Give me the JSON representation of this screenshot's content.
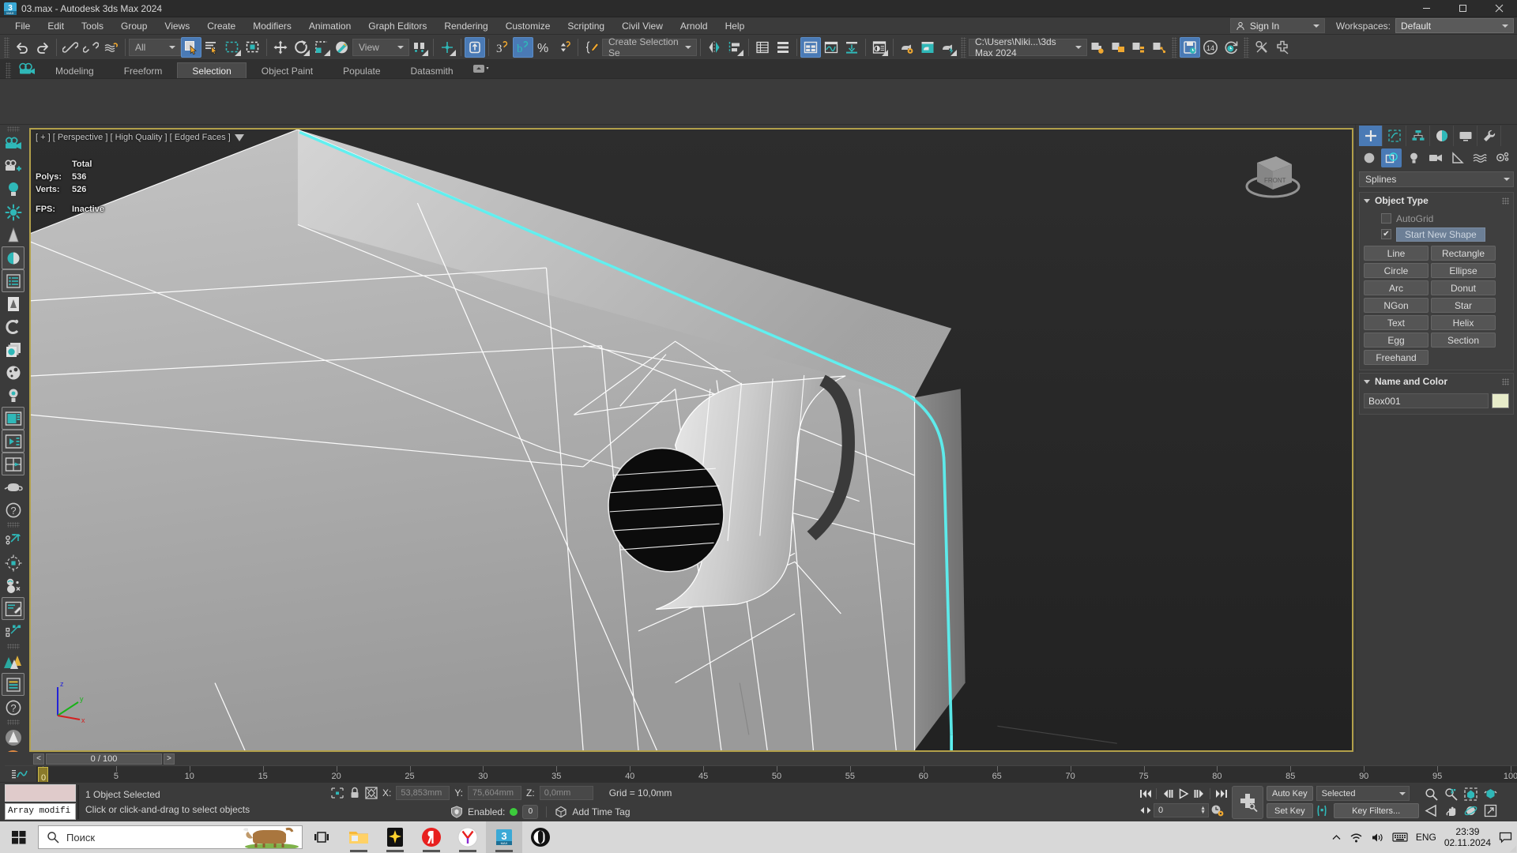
{
  "window": {
    "title": "03.max - Autodesk 3ds Max 2024",
    "app_icon": "3dsmax-icon",
    "minimize": "minimize-icon",
    "maximize": "maximize-icon",
    "close": "close-icon"
  },
  "menubar": {
    "items": [
      "File",
      "Edit",
      "Tools",
      "Group",
      "Views",
      "Create",
      "Modifiers",
      "Animation",
      "Graph Editors",
      "Rendering",
      "Customize",
      "Scripting",
      "Civil View",
      "Arnold",
      "Help"
    ],
    "sign_in": "Sign In",
    "workspaces_label": "Workspaces:",
    "workspace_value": "Default"
  },
  "toolbar": {
    "undo": "undo-icon",
    "redo": "redo-icon",
    "select_and_link": "select-and-link-icon",
    "unlink_selection": "unlink-selection-icon",
    "bind_to_space_warp": "bind-space-warp-icon",
    "filter_value": "All",
    "select_object": "select-object-icon",
    "select_by_name": "select-by-name-icon",
    "rectangular_select": "rectangular-selection-icon",
    "window_crossing": "window-crossing-icon",
    "select_and_move": "select-and-move-icon",
    "select_and_rotate": "select-and-rotate-icon",
    "select_and_scale": "select-and-scale-icon",
    "placement": "placement-icon",
    "reference_coord_value": "View",
    "use_center": "use-pivot-center-icon",
    "select_and_manipulate": "select-and-manipulate-icon",
    "snaps_toggle": "snaps-toggle-icon",
    "angle_snap": "angle-snap-icon",
    "percent_snap": "percent-snap-icon",
    "spinner_snap": "spinner-snap-icon",
    "edit_named_sets": "edit-named-selection-sets-icon",
    "selection_set_value": "Create Selection Se",
    "mirror": "mirror-icon",
    "align": "align-icon",
    "layer_explorer": "layer-explorer-icon",
    "scene_explorer": "scene-explorer-icon",
    "toggle_ribbon": "toggle-ribbon-icon",
    "curve_editor": "curve-editor-icon",
    "schematic_view": "schematic-view-icon",
    "material_editor": "material-editor-icon",
    "render_setup": "render-setup-icon",
    "rendered_frame_window": "rendered-frame-window-icon",
    "render_production": "render-production-icon",
    "project_path_value": "C:\\Users\\Niki...\\3ds Max 2024",
    "render_in_cloud": "render-in-cloud-icon",
    "open_folder": "open-folder-icon",
    "state_sets": "state-sets-icon",
    "scene_converter": "scene-converter-icon",
    "autobackup": "autobackup-toggle-icon",
    "autobackup_minutes": "14",
    "restore_autobackup": "restore-autobackup-icon",
    "arnold_tools": "arnold-tools-icon",
    "add_plugin": "add-plugin-icon"
  },
  "ribbon": {
    "tabs": [
      "Modeling",
      "Freeform",
      "Selection",
      "Object Paint",
      "Populate",
      "Datasmith"
    ],
    "active_tab": "Selection",
    "minimize_icon": "ribbon-minimize-icon"
  },
  "left_toolbar": {
    "items": [
      "camera-icon",
      "create-camera-icon",
      "light-bulb-icon",
      "sun-light-icon",
      "tree-object-icon",
      "material-preview-icon",
      "list-properties-icon",
      "vegetation-icon",
      "spiral-icon",
      "layers-stack-icon",
      "palette-icon",
      "daylight-bulb-icon",
      "viewport-panel-icon",
      "playback-panel-icon",
      "quad-layout-icon",
      "teapot-icon",
      "help-circle-icon",
      "select-points-icon",
      "transform-center-icon",
      "sphere-tools-icon",
      "paint-tools-icon",
      "sub-object-select-icon",
      "forest-pack-icon",
      "list-editor-icon",
      "help-question-icon",
      "render-preview-icon"
    ],
    "color_orange": "#e08a42",
    "color_globe": "#d4823c"
  },
  "viewport": {
    "label": "[ + ] [ Perspective ] [ High Quality ] [ Edged Faces ]",
    "filter_icon": "viewport-filter-icon",
    "stats": {
      "header": "Total",
      "polys_label": "Polys:",
      "polys_value": "536",
      "verts_label": "Verts:",
      "verts_value": "526",
      "fps_label": "FPS:",
      "fps_value": "Inactive"
    },
    "viewcube_label": "FRONT",
    "axis": {
      "x": "x",
      "y": "y",
      "z": "z"
    },
    "selection_highlight_color": "#5cf0f0",
    "border_color": "#b2a04a"
  },
  "command_panel": {
    "tabs": [
      {
        "name": "create-tab",
        "icon": "plus-icon",
        "active": true
      },
      {
        "name": "modify-tab",
        "icon": "modify-icon",
        "active": false
      },
      {
        "name": "hierarchy-tab",
        "icon": "hierarchy-icon",
        "active": false
      },
      {
        "name": "motion-tab",
        "icon": "motion-icon",
        "active": false
      },
      {
        "name": "display-tab",
        "icon": "display-monitor-icon",
        "active": false
      },
      {
        "name": "utilities-tab",
        "icon": "wrench-icon",
        "active": false
      }
    ],
    "category_buttons": [
      {
        "name": "geometry-button",
        "icon": "sphere-icon",
        "active": false
      },
      {
        "name": "shapes-button",
        "icon": "shapes-icon",
        "active": true
      },
      {
        "name": "lights-button",
        "icon": "light-icon",
        "active": false
      },
      {
        "name": "cameras-button",
        "icon": "camera-icon",
        "active": false
      },
      {
        "name": "helpers-button",
        "icon": "helpers-icon",
        "active": false
      },
      {
        "name": "space-warps-button",
        "icon": "space-warps-icon",
        "active": false
      },
      {
        "name": "systems-button",
        "icon": "systems-icon",
        "active": false
      }
    ],
    "dropdown_value": "Splines",
    "object_type": {
      "title": "Object Type",
      "autogrid_label": "AutoGrid",
      "autogrid_checked": false,
      "start_new_shape_label": "Start New Shape",
      "start_new_shape_checked": true,
      "buttons": [
        "Line",
        "Rectangle",
        "Circle",
        "Ellipse",
        "Arc",
        "Donut",
        "NGon",
        "Star",
        "Text",
        "Helix",
        "Egg",
        "Section",
        "Freehand"
      ]
    },
    "name_and_color": {
      "title": "Name and Color",
      "name_value": "Box001",
      "color": "#e7ebc9"
    }
  },
  "timeline": {
    "prev_frame": "<",
    "frame_display": "0 / 100",
    "next_frame": ">",
    "track_icon": "track-view-icon",
    "current_frame": "0",
    "ticks": [
      "0",
      "5",
      "10",
      "15",
      "20",
      "25",
      "30",
      "35",
      "40",
      "45",
      "50",
      "55",
      "60",
      "65",
      "70",
      "75",
      "80",
      "85",
      "90",
      "95",
      "100"
    ]
  },
  "status_bar": {
    "array_field": "Array modifi",
    "objects_selected": "1 Object Selected",
    "prompt": "Click or click-and-drag to select objects",
    "selection_lock_icon": "selection-lock-icon",
    "lock_icon": "lock-icon",
    "absolute_mode_icon": "absolute-mode-transform-icon",
    "x_label": "X:",
    "x_value": "53,853mm",
    "y_label": "Y:",
    "y_value": "75,604mm",
    "z_label": "Z:",
    "z_value": "0,0mm",
    "grid_text": "Grid = 10,0mm",
    "isolate_icon": "isolate-selection-icon",
    "enabled_label": "Enabled:",
    "enabled_state": "on",
    "enabled_count": "0",
    "add_time_tag": "Add Time Tag",
    "auto_key": "Auto Key",
    "set_key": "Set Key",
    "key_mode_value": "Selected",
    "key_filters": "Key Filters...",
    "frame_spinner": "0",
    "playback": {
      "go_to_start": "go-to-start-icon",
      "previous_frame": "previous-frame-icon",
      "play": "play-icon",
      "next_frame": "next-frame-icon",
      "go_to_end": "go-to-end-icon",
      "key_mode": "key-mode-toggle-icon",
      "time_config": "time-configuration-icon"
    },
    "nav": [
      "zoom-icon",
      "zoom-all-icon",
      "zoom-extents-icon",
      "zoom-region-icon",
      "field-of-view-icon",
      "pan-icon",
      "orbit-icon",
      "maximize-viewport-icon"
    ]
  },
  "taskbar": {
    "start": "windows-start-icon",
    "search_placeholder": "Поиск",
    "search_icon": "search-icon",
    "cow_icon": "cow-mascot-icon",
    "task_view": "task-view-icon",
    "apps": [
      {
        "name": "file-explorer-icon",
        "label": "File Explorer"
      },
      {
        "name": "sparkle-app-icon",
        "label": "Sparkle"
      },
      {
        "name": "yandex-icon",
        "label": "Yandex"
      },
      {
        "name": "yandex-browser-icon",
        "label": "Yandex Browser"
      },
      {
        "name": "3dsmax-taskbar-icon",
        "label": "3ds Max"
      },
      {
        "name": "unreal-engine-icon",
        "label": "Unreal Engine"
      }
    ],
    "tray": {
      "show_hidden": "chevron-up-icon",
      "network": "wifi-icon",
      "volume": "speaker-icon",
      "keyboard": "keyboard-icon",
      "language": "ENG",
      "time": "23:39",
      "date": "02.11.2024",
      "notifications": "notification-icon"
    }
  }
}
